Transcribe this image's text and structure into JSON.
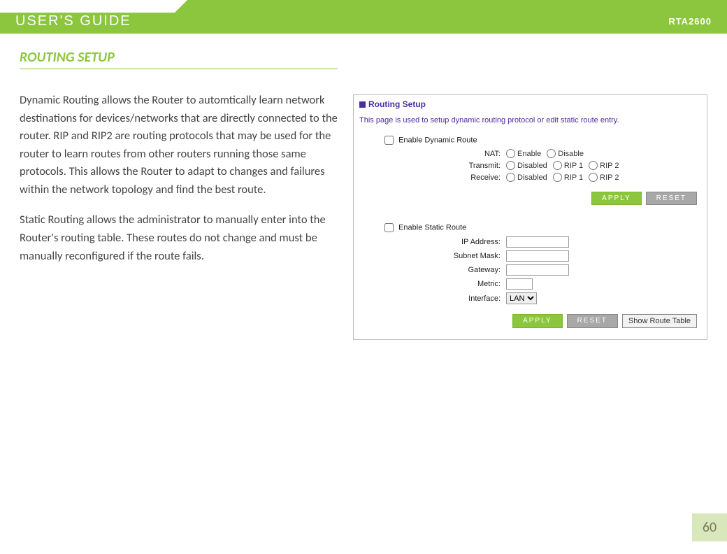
{
  "header": {
    "title": "USER'S GUIDE",
    "model": "RTA2600"
  },
  "page": {
    "section_title": "ROUTING SETUP",
    "paragraph1": "Dynamic Routing allows the Router to automtically learn network destinations for devices/networks that are directly connected to the router. RIP and RIP2 are routing protocols that may be used for the router to learn routes from other routers running those same protocols. This allows the Router to adapt to changes and failures within the network topology and find the best route.",
    "paragraph2": "Static Routing allows the administrator to manually enter into the Router's routing table. These routes do not change and must be manually reconfigured if the route fails.",
    "page_number": "60"
  },
  "screenshot": {
    "panel_title": "Routing Setup",
    "description": "This page is used to setup dynamic routing protocol or edit static route entry.",
    "dynamic": {
      "enable_label": "Enable Dynamic Route",
      "nat_label": "NAT:",
      "nat_enable": "Enable",
      "nat_disable": "Disable",
      "transmit_label": "Transmit:",
      "receive_label": "Receive:",
      "opt_disabled": "Disabled",
      "opt_rip1": "RIP 1",
      "opt_rip2": "RIP 2"
    },
    "static": {
      "enable_label": "Enable Static Route",
      "ip_label": "IP Address:",
      "subnet_label": "Subnet Mask:",
      "gateway_label": "Gateway:",
      "metric_label": "Metric:",
      "interface_label": "Interface:",
      "interface_option": "LAN"
    },
    "buttons": {
      "apply": "APPLY",
      "reset": "RESET",
      "show_route": "Show Route Table"
    }
  }
}
